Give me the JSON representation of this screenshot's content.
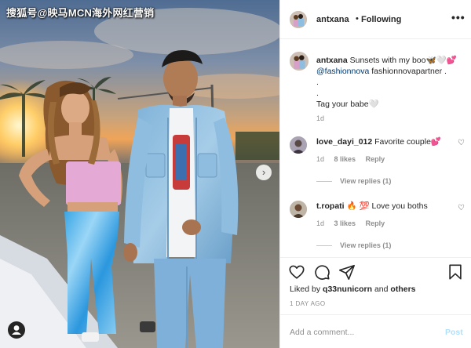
{
  "watermark": "搜狐号@映马MCN海外网红营销",
  "photo": {
    "next_icon": "chevron-right-icon",
    "tag_icon": "user-tag-icon"
  },
  "header": {
    "username": "antxana",
    "separator": "•",
    "follow_status": "Following",
    "more_label": "•••"
  },
  "caption": {
    "username": "antxana",
    "text": "Sunsets with my boo🦋🤍💕",
    "mention": "@fashionnova",
    "text_after": "fashionnovapartner .",
    "line2": ".",
    "line3": ".",
    "line4": "Tag your babe🤍",
    "time": "1d"
  },
  "comments": [
    {
      "username": "love_dayi_012",
      "text": "Favorite couple💕",
      "time": "1d",
      "likes": "8 likes",
      "reply": "Reply",
      "view_replies": "View replies (1)"
    },
    {
      "username": "t.ropati",
      "text": "🔥 💯 Love you boths",
      "time": "1d",
      "likes": "3 likes",
      "reply": "Reply",
      "view_replies": "View replies (1)"
    }
  ],
  "actions": {
    "icons": [
      "heart-icon",
      "comment-icon",
      "share-icon",
      "bookmark-icon"
    ],
    "liked_by_prefix": "Liked by",
    "liked_by_user": "q33nunicorn",
    "liked_by_join": "and",
    "liked_by_others": "others",
    "post_time": "1 DAY AGO"
  },
  "add_comment": {
    "placeholder": "Add a comment...",
    "post_label": "Post"
  },
  "colors": {
    "link": "#00376b",
    "muted": "#8e8e8e",
    "post_disabled": "#b2dffc",
    "text": "#262626"
  }
}
